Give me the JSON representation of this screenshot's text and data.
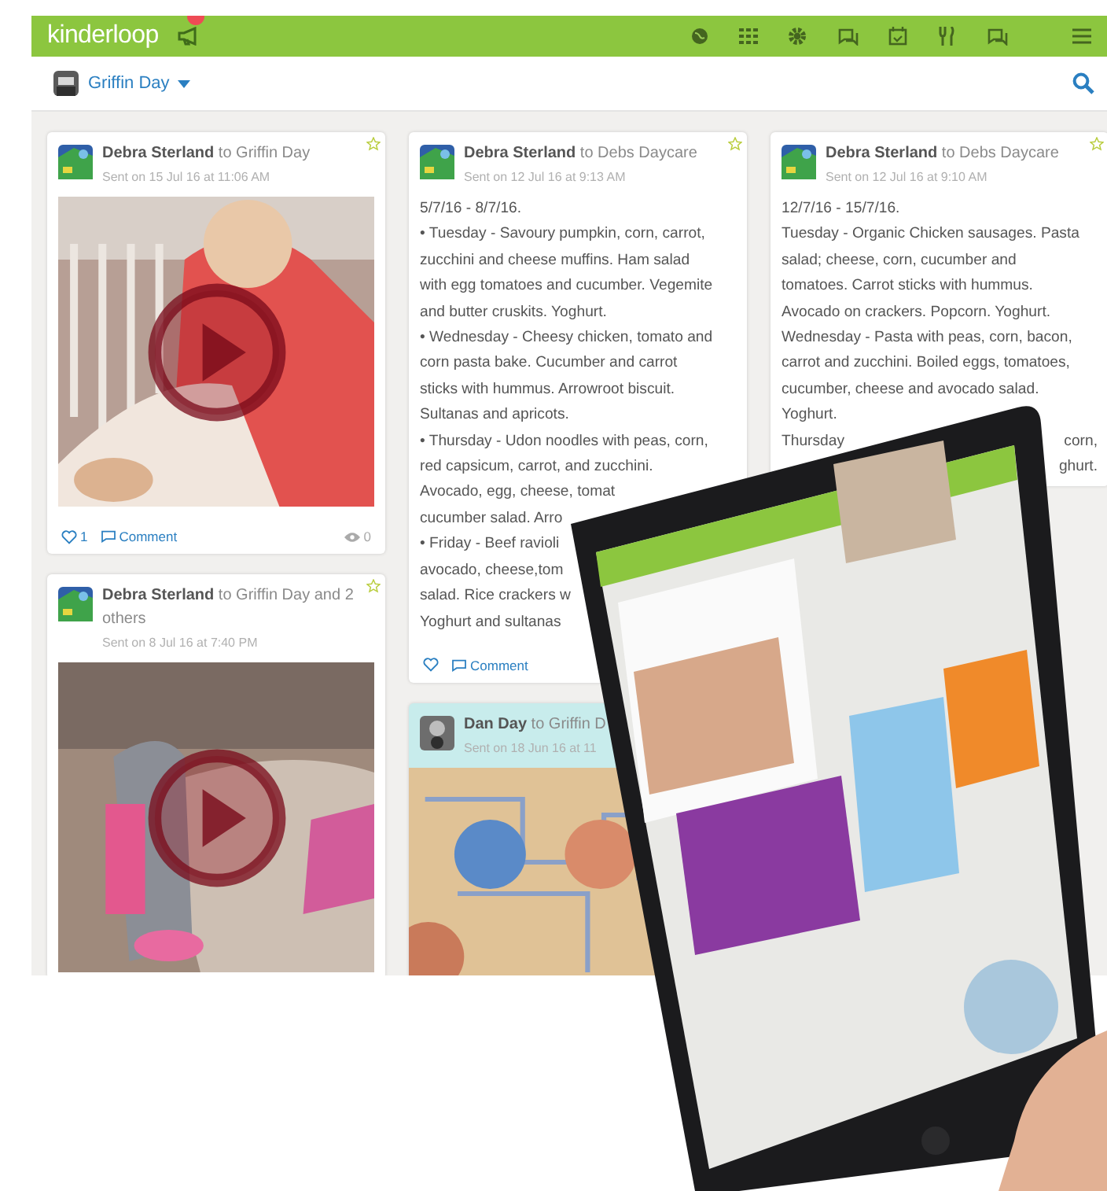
{
  "app": {
    "logo": "kinderloop",
    "has_notification": true
  },
  "child_selector": {
    "name": "Griffin Day"
  },
  "columns": [
    [
      {
        "kind": "video",
        "header": "**Debra Sterland** to Griffin Day",
        "sent": "Sent on 15 Jul 16 at 11:06 AM",
        "highlighted": false,
        "footer": {
          "likes": "1",
          "comment": "Comment",
          "views": "0"
        }
      },
      {
        "kind": "video",
        "header": "**Debra Sterland** to Griffin Day and 2 others",
        "sent": "Sent on 8 Jul 16 at 7:40 PM",
        "highlighted": false
      }
    ],
    [
      {
        "kind": "text",
        "header": "**Debra Sterland** to Debs Daycare",
        "sent": "Sent on 12 Jul 16 at 9:13 AM",
        "highlighted": false,
        "lines": [
          {
            "text": "5/7/16 - 8/7/16."
          },
          {
            "text": "• Tuesday - Savoury pumpkin, corn, carrot,"
          },
          {
            "text": "zucchini and cheese muffins. Ham salad"
          },
          {
            "text": "with egg tomatoes and cucumber. Vegemite"
          },
          {
            "text": "and butter cruskits. Yoghurt."
          },
          {
            "text": "• Wednesday - Cheesy chicken, tomato and"
          },
          {
            "text": "corn pasta bake. Cucumber and carrot"
          },
          {
            "text": "sticks with hummus. Arrowroot biscuit."
          },
          {
            "text": "Sultanas and apricots."
          },
          {
            "text": "• Thursday - Udon noodles with peas, corn,"
          },
          {
            "text": "red capsicum, carrot, and zucchini."
          },
          {
            "text": "Avocado, egg, cheese, tomat"
          },
          {
            "text": "cucumber salad. Arro"
          },
          {
            "text": "• Friday - Beef ravioli"
          },
          {
            "text": "avocado, cheese,tom"
          },
          {
            "text": "salad. Rice crackers w"
          },
          {
            "text": "Yoghurt and sultanas"
          }
        ],
        "footer": {
          "comment": "Comment"
        }
      },
      {
        "header": "**Dan Day** to Griffin D",
        "sent": "Sent on 18 Jun 16 at 11",
        "highlighted": true
      }
    ],
    [
      {
        "kind": "text",
        "header": "**Debra Sterland** to Debs Daycare",
        "sent": "Sent on 12 Jul 16 at 9:10 AM",
        "highlighted": false,
        "lines": [
          {
            "text": "12/7/16 - 15/7/16."
          },
          {
            "text": "Tuesday - Organic Chicken sausages. Pasta"
          },
          {
            "text": "salad; cheese, corn, cucumber and"
          },
          {
            "text": "tomatoes. Carrot sticks with hummus."
          },
          {
            "text": "Avocado on crackers. Popcorn. Yoghurt."
          },
          {
            "text": "Wednesday - Pasta with peas, corn, bacon,"
          },
          {
            "text": "carrot and zucchini. Boiled eggs, tomatoes,"
          },
          {
            "text": "cucumber, cheese and avocado salad."
          },
          {
            "text": "Yoghurt."
          },
          {
            "text": "Thursday",
            "tail": "corn,"
          },
          {
            "tail": "ghurt."
          }
        ]
      }
    ]
  ]
}
